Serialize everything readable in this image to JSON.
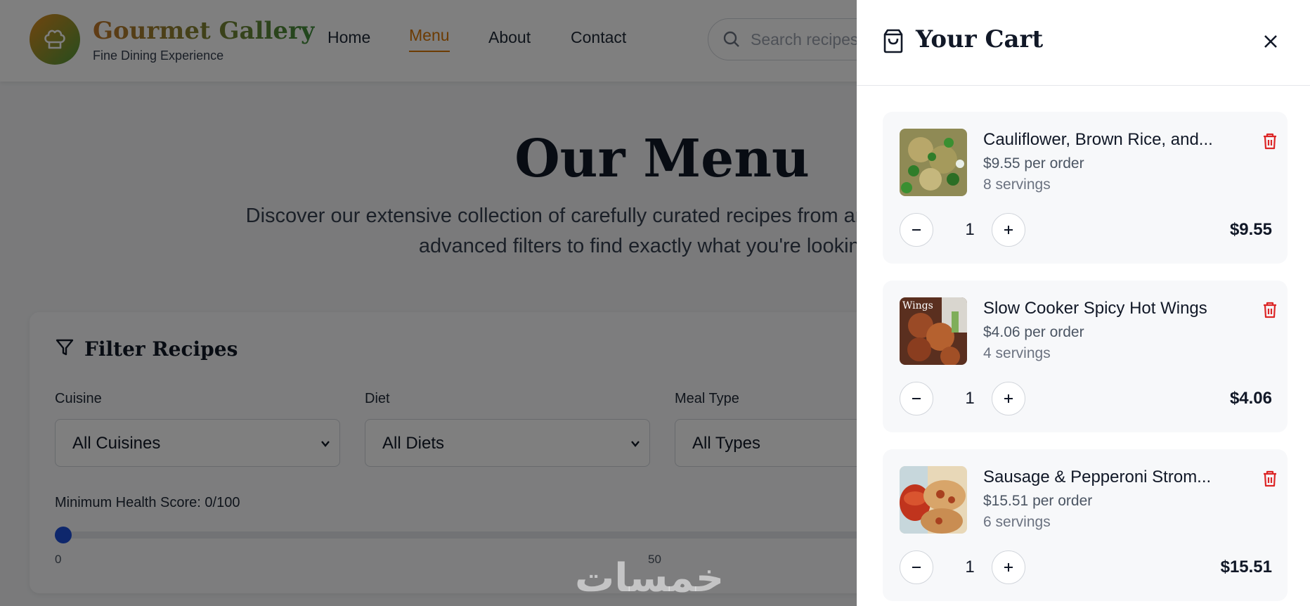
{
  "header": {
    "brand_title": "Gourmet Gallery",
    "brand_subtitle": "Fine Dining Experience",
    "nav": [
      {
        "label": "Home",
        "active": false
      },
      {
        "label": "Menu",
        "active": true
      },
      {
        "label": "About",
        "active": false
      },
      {
        "label": "Contact",
        "active": false
      }
    ],
    "search_placeholder": "Search recipes..."
  },
  "hero": {
    "title": "Our Menu",
    "text": "Discover our extensive collection of carefully curated recipes from around the world. Use our advanced filters to find exactly what you're looking for."
  },
  "filters": {
    "title": "Filter Recipes",
    "cuisine_label": "Cuisine",
    "cuisine_value": "All Cuisines",
    "diet_label": "Diet",
    "diet_value": "All Diets",
    "meal_label": "Meal Type",
    "meal_value": "All Types",
    "health_label": "Minimum Health Score: 0/100",
    "health_value": 0,
    "tick_min": "0",
    "tick_mid": "50"
  },
  "cart": {
    "title": "Your Cart",
    "items": [
      {
        "name": "Cauliflower, Brown Rice, and...",
        "price": "$9.55 per order",
        "servings": "8 servings",
        "qty": "1",
        "total": "$9.55"
      },
      {
        "name": "Slow Cooker Spicy Hot Wings",
        "price": "$4.06 per order",
        "servings": "4 servings",
        "qty": "1",
        "total": "$4.06",
        "thumb_text": "Wings"
      },
      {
        "name": "Sausage & Pepperoni Strom...",
        "price": "$15.51 per order",
        "servings": "6 servings",
        "qty": "1",
        "total": "$15.51"
      }
    ]
  },
  "watermark": "خمسات",
  "colors": {
    "accent": "#d97706",
    "slider": "#1d4ed8",
    "trash": "#dc2626"
  }
}
